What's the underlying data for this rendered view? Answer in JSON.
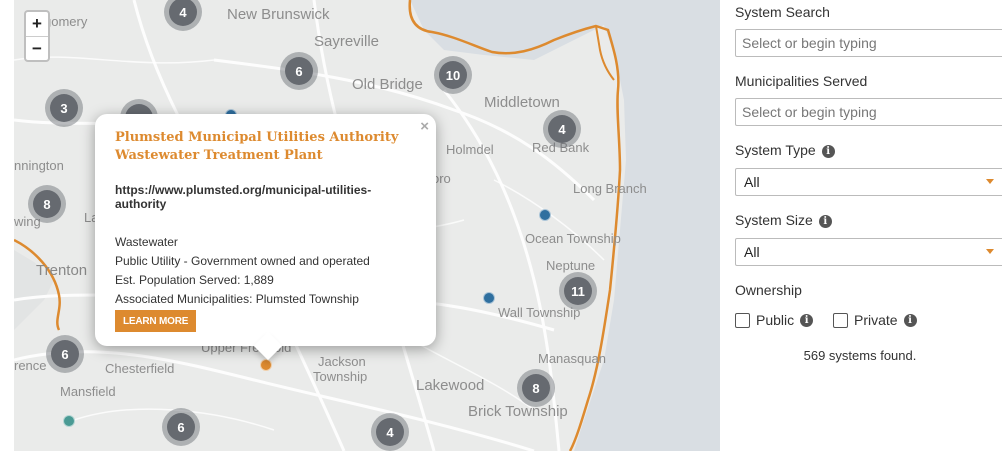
{
  "map": {
    "zoom_in": "+",
    "zoom_out": "−",
    "places": [
      {
        "name": "gomery"
      },
      {
        "name": "New Brunswick"
      },
      {
        "name": "Sayreville"
      },
      {
        "name": "Old Bridge"
      },
      {
        "name": "Middletown"
      },
      {
        "name": "Holmdel"
      },
      {
        "name": "Red Bank"
      },
      {
        "name": "Long Branch"
      },
      {
        "name": "Ocean Township"
      },
      {
        "name": "Neptune"
      },
      {
        "name": "Wall Township"
      },
      {
        "name": "Manasquan"
      },
      {
        "name": "Jackson"
      },
      {
        "name": "Township"
      },
      {
        "name": "Lakewood"
      },
      {
        "name": "Brick Township"
      },
      {
        "name": "Chesterfield"
      },
      {
        "name": "Mansfield"
      },
      {
        "name": "Trenton"
      },
      {
        "name": "nnington"
      },
      {
        "name": "wing"
      },
      {
        "name": "La"
      },
      {
        "name": "rence"
      },
      {
        "name": "oro"
      },
      {
        "name": "Upper Freehold"
      }
    ],
    "clusters": [
      {
        "count": "4"
      },
      {
        "count": "6"
      },
      {
        "count": "10"
      },
      {
        "count": "3"
      },
      {
        "count": "4"
      },
      {
        "count": "8"
      },
      {
        "count": "11"
      },
      {
        "count": "6"
      },
      {
        "count": "8"
      },
      {
        "count": "6"
      },
      {
        "count": "4"
      }
    ],
    "colors": {
      "cluster": "#666a70",
      "dot_blue": "#2f6f9f",
      "dot_teal": "#4a9a94",
      "dot_orange": "#dd8a2f",
      "boundary": "#dd8a2f",
      "water": "#d7dde3"
    }
  },
  "popup": {
    "title_line1": "Plumsted Municipal Utilities Authority",
    "title_line2": "Wastewater Treatment Plant",
    "url": "https://www.plumsted.org/municipal-utilities-authority",
    "type": "Wastewater",
    "ownership": "Public Utility - Government owned and operated",
    "population": "Est. Population Served: 1,889",
    "municipalities": "Associated Municipalities: Plumsted Township",
    "learn_more": "LEARN MORE",
    "close": "×"
  },
  "sidebar": {
    "system_search_label": "System Search",
    "system_search_placeholder": "Select or begin typing",
    "municipalities_label": "Municipalities Served",
    "municipalities_placeholder": "Select or begin typing",
    "system_type_label": "System Type",
    "system_type_value": "All",
    "system_size_label": "System Size",
    "system_size_value": "All",
    "ownership_label": "Ownership",
    "public_label": "Public",
    "private_label": "Private",
    "info_icon": "i",
    "found_text": "569 systems found."
  }
}
